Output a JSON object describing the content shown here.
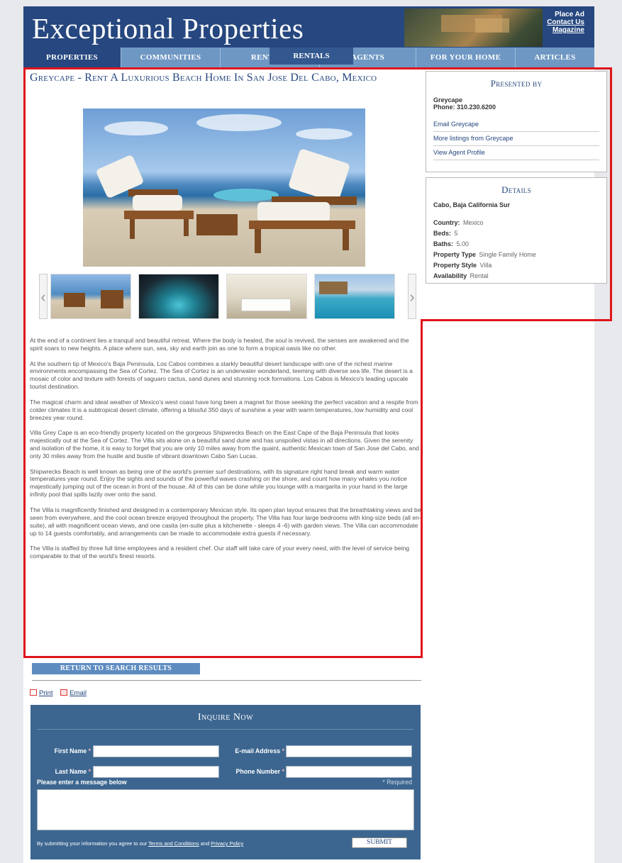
{
  "header": {
    "logo": "Exceptional Properties",
    "links": [
      "Place Ad",
      "Contact Us",
      "Magazine"
    ]
  },
  "nav": {
    "items": [
      "Properties",
      "Communities",
      "Rentals",
      "Agents",
      "For your home",
      "Articles"
    ],
    "hover_label": "Rentals"
  },
  "listing": {
    "title": "Greycape - Rent A Luxurious Beach Home In San Jose Del Cabo, Mexico",
    "thumbnails": [
      "beach-chairs-thumb",
      "night-pool-thumb",
      "interior-thumb",
      "infinity-pool-thumb"
    ],
    "paragraphs": [
      "At the end of a continent lies a tranquil and beautiful retreat. Where the body is healed, the soul is revived, the senses are awakened and the spirit soars to new heights. A place where sun, sea, sky and earth join as one to form a tropical oasis like no other.",
      "At the southern tip of Mexico's Baja Peninsula, Los Cabos combines a starkly beautiful desert landscape with one of the richest marine environments encompassing the Sea of Cortez. The Sea of Cortez is an underwater wonderland, teeming with diverse sea life. The desert is a mosaic of color and texture with forests of saguaro cactus, sand dunes and stunning rock formations. Los Cabos is Mexico's leading upscale tourist destination.",
      "The magical charm and ideal weather of Mexico's west coast have long been a magnet for those seeking the perfect vacation and a respite from colder climates It is a subtropical desert climate, offering a blissful 350 days of sunshine a year with warm temperatures, low humidity and cool breezes year round.",
      "Villa Grey Cape is an eco-friendly property located on the gorgeous Shipwrecks Beach on the East Cape of the Baja Peninsula that looks majestically out at the Sea of Cortez. The Villa sits alone on a beautiful sand dune and has unspoiled vistas in all directions. Given the serenity and isolation of the home, it is easy to forget that you are only 10 miles away from the quaint, authentic Mexican town of San Jose del Cabo, and only 30 miles away from the hustle and bustle of vibrant downtown Cabo San Lucas.",
      "Shipwrecks Beach is well known as being one of the world's premier surf destinations, with its signature right hand break and warm water temperatures year round. Enjoy the sights and sounds of the powerful waves crashing on the shore, and count how many whales you notice majestically jumping out of the ocean in front of the house. All of this can be done while you lounge with a margarita in your hand in the large infinity pool that spills lazily over onto the sand.",
      "The Villa is magnificently finished and designed in a contemporary Mexican style. Its open plan layout ensures that the breathtaking views and be seen from everywhere, and the cool ocean breeze enjoyed throughout the property. The Villa has four large bedrooms with king-size beds (all en-suite), all with magnificent ocean views, and one casita (en-suite plus a kitchenette - sleeps 4 -6) with garden views. The Villa can accommodate up to 14 guests comfortably, and arrangements can be made to accommodate extra guests if necessary.",
      "The Villa is staffed by three full time employees and a resident chef. Our staff will take care of your every need, with the level of service being comparable to that of the world's finest resorts."
    ]
  },
  "presented": {
    "heading": "Presented by",
    "name": "Greycape",
    "phone": "Phone: 310.230.6200",
    "links": [
      "Email Greycape",
      "More listings from Greycape",
      "View Agent Profile"
    ]
  },
  "details": {
    "heading": "Details",
    "location": "Cabo, Baja California Sur",
    "rows": [
      {
        "label": "Country:",
        "value": "Mexico"
      },
      {
        "label": "Beds:",
        "value": "5"
      },
      {
        "label": "Baths:",
        "value": "5.00"
      },
      {
        "label": "Property Type",
        "value": "Single Family Home"
      },
      {
        "label": "Property Style",
        "value": "Villa"
      },
      {
        "label": "Availability",
        "value": "Rental"
      }
    ]
  },
  "actions": {
    "return": "Return to search results",
    "print": "Print",
    "email": "Email"
  },
  "inquire": {
    "heading": "Inquire Now",
    "first_name": "First Name",
    "last_name": "Last Name",
    "email": "E-mail Address",
    "phone": "Phone Number",
    "asterisk": "*",
    "message_label": "Please enter a message below",
    "required_note": "* Required",
    "terms_prefix": "By submitting your information you agree to our",
    "terms_link": "Terms and Conditions",
    "terms_and": "and",
    "privacy_link": "Privacy Policy",
    "submit": "Submit"
  },
  "colors": {
    "brand": "#26477f",
    "nav": "#6f97c3",
    "highlight": "#e0141b",
    "form_bg": "#3c6690"
  }
}
